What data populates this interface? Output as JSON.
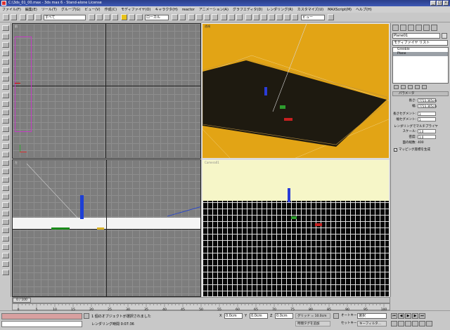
{
  "window": {
    "title": "C:\\3ds_01_00.max - 3ds max 6 - Stand-alone License",
    "btn_min": "_",
    "btn_max": "□",
    "btn_close": "×"
  },
  "menu": [
    "ファイル(F)",
    "編集(E)",
    "ツール(T)",
    "グループ(G)",
    "ビュー(V)",
    "作成(C)",
    "モディファイヤ(O)",
    "キャラクタ(H)",
    "reactor",
    "アニメーション(A)",
    "グラフエディタ(D)",
    "レンダリング(R)",
    "カスタマイズ(U)",
    "MAXScript(M)",
    "ヘルプ(H)"
  ],
  "toolbar": {
    "selection_filter": "すべて",
    "coord_system": "ローカル",
    "named_selection": "ビュー"
  },
  "viewports": {
    "front": {
      "label": "前"
    },
    "perspective": {
      "label": "透視"
    },
    "left": {
      "label": "左"
    },
    "camera": {
      "label": "Camera01"
    }
  },
  "command_panel": {
    "object_name": "Plane01",
    "modifier_list": "モディファイヤ リスト",
    "stack": [
      "Greeble",
      "Plane"
    ],
    "rollout_title": "パラメータ",
    "params": [
      {
        "label": "長さ:",
        "value": "7723.365cm"
      },
      {
        "label": "幅:",
        "value": "7723.365cm"
      },
      {
        "label": "長さセグメント:",
        "value": "1"
      },
      {
        "label": "幅セグメント:",
        "value": "1"
      }
    ],
    "render_group": "レンダリングでマルチプライヤ",
    "render_params": [
      {
        "label": "スケール:",
        "value": "1.0"
      },
      {
        "label": "密度:",
        "value": "1.0"
      },
      {
        "label": "面の総数:",
        "value": "400"
      }
    ],
    "mapping_label": "マッピング座標を生成"
  },
  "timeline": {
    "frame": "0 / 100",
    "ticks": [
      "0",
      "5",
      "10",
      "15",
      "20",
      "25",
      "30",
      "35",
      "40",
      "45",
      "50",
      "55",
      "60",
      "65",
      "70",
      "75",
      "80",
      "85",
      "90",
      "95",
      "100"
    ]
  },
  "status": {
    "selected": "1 個のオブジェクトが選択されました",
    "render_time": "レンダリング時間 0:07:36",
    "coord_x": "0.0cm",
    "coord_y": "0.0cm",
    "coord_z": "0.0cm",
    "grid": "グリッド = 10.0cm",
    "add_time_tag": "時間タグを追加",
    "autokey": "オートキー",
    "setkey": "セットキー",
    "key_mode": "選択",
    "key_filter": "キーフィルタ..."
  }
}
